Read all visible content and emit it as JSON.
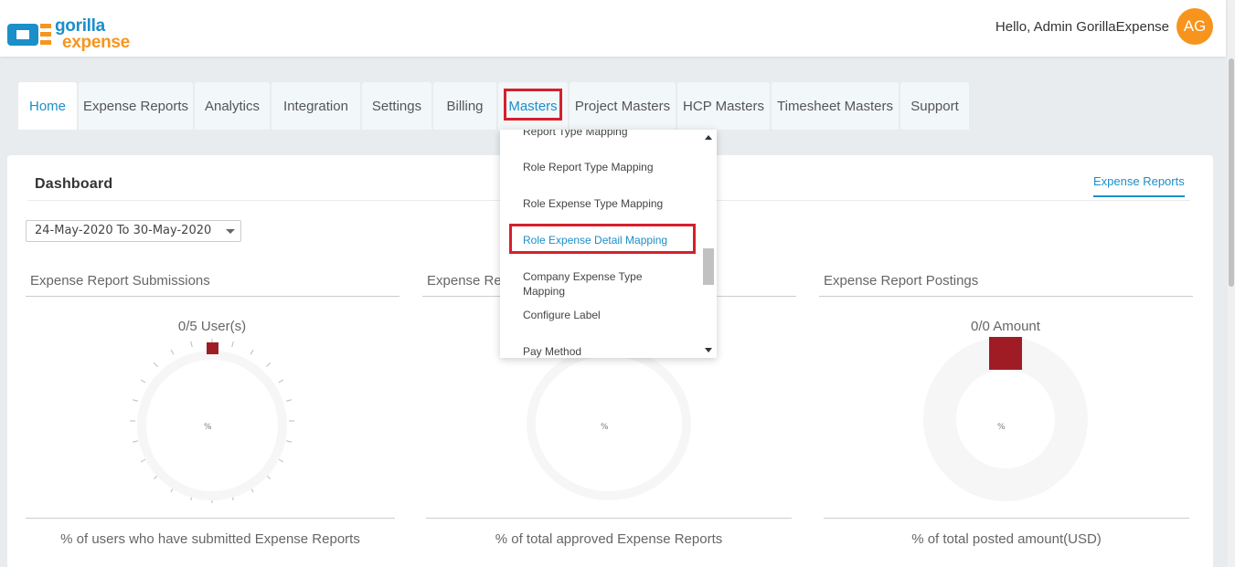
{
  "header": {
    "logo_top": "gorilla",
    "logo_bottom": "expense",
    "greeting": "Hello, Admin GorillaExpense",
    "avatar_initials": "AG"
  },
  "tabs": [
    {
      "label": "Home"
    },
    {
      "label": "Expense Reports"
    },
    {
      "label": "Analytics"
    },
    {
      "label": "Integration"
    },
    {
      "label": "Settings"
    },
    {
      "label": "Billing"
    },
    {
      "label": "Masters"
    },
    {
      "label": "Project Masters"
    },
    {
      "label": "HCP Masters"
    },
    {
      "label": "Timesheet Masters"
    },
    {
      "label": "Support"
    }
  ],
  "dashboard": {
    "title": "Dashboard",
    "expense_reports_link": "Expense Reports",
    "date_range": "24-May-2020 To 30-May-2020"
  },
  "panels": [
    {
      "title": "Expense Report Submissions",
      "stat": "0/5 User(s)",
      "pct": "%",
      "caption": "% of users who have submitted Expense Reports"
    },
    {
      "title": "Expense Re",
      "stat": "",
      "pct": "%",
      "caption": "% of total approved Expense Reports"
    },
    {
      "title": "Expense Report Postings",
      "stat": "0/0 Amount",
      "pct": "%",
      "caption": "% of total posted amount(USD)"
    }
  ],
  "masters_dropdown": {
    "items": [
      "Report Type Mapping",
      "Role Report Type Mapping",
      "Role Expense Type Mapping",
      "Role Expense Detail Mapping",
      "Company Expense Type Mapping",
      "Configure Label",
      "Pay Method"
    ],
    "selected": "Role Expense Detail Mapping"
  },
  "colors": {
    "accent": "#1b8fc9",
    "brand_orange": "#f7941d",
    "highlight_red": "#d61f2c",
    "marker": "#a01c24"
  }
}
